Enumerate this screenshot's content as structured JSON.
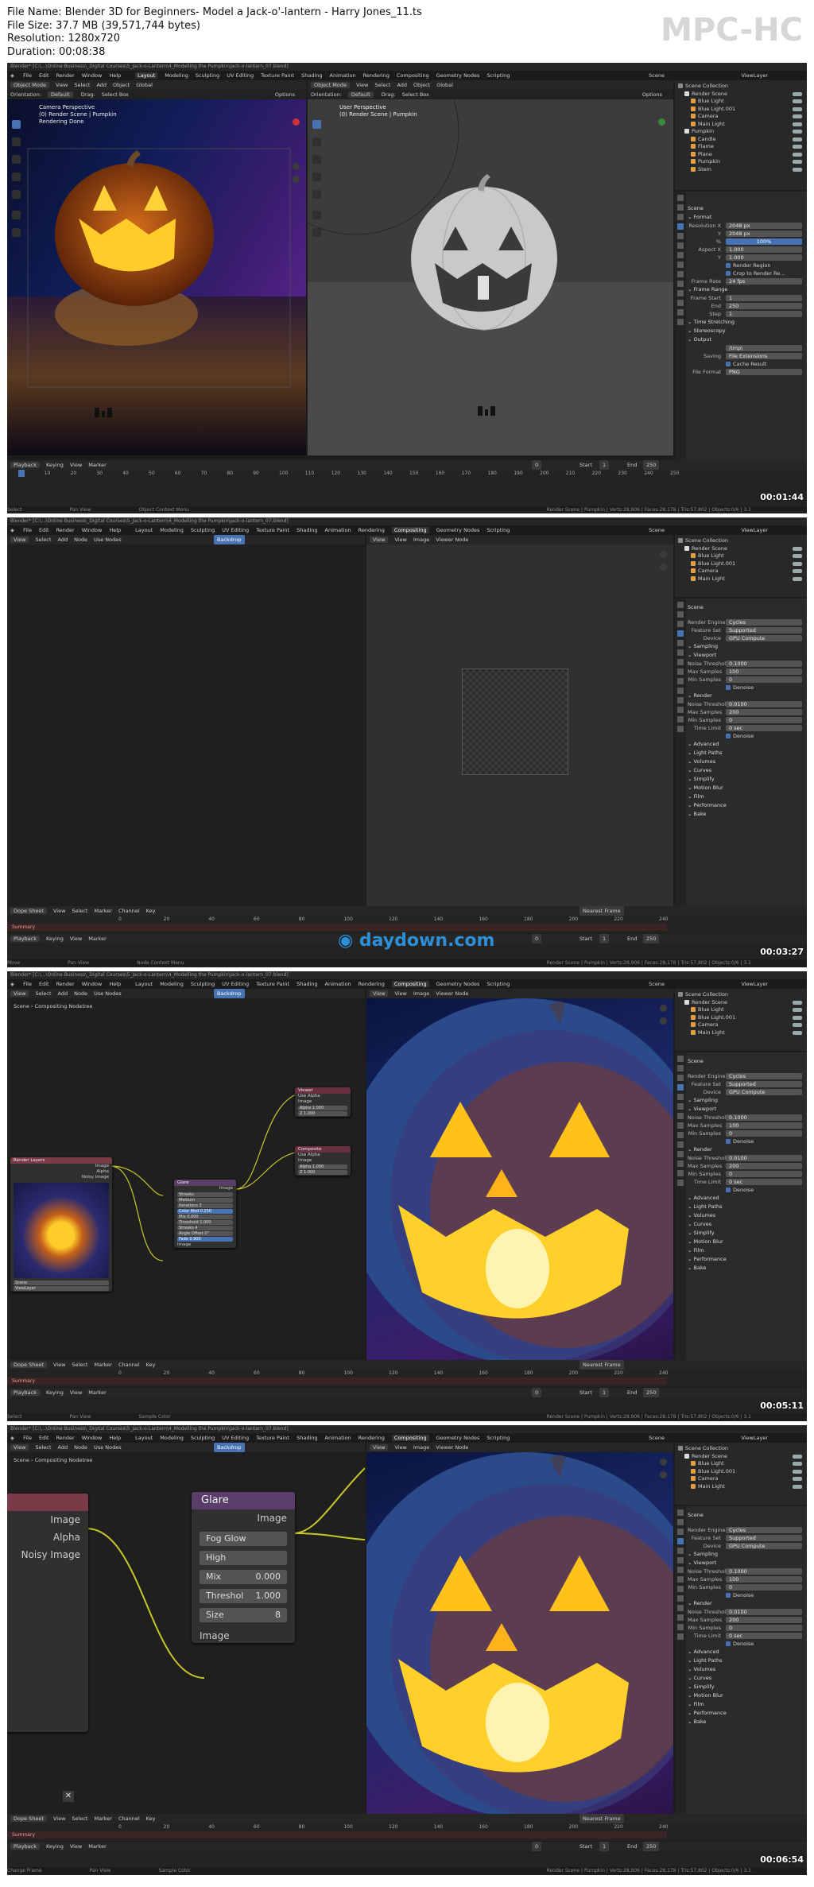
{
  "file_info": {
    "name_label": "File Name:",
    "name": "Blender 3D for Beginners- Model a Jack-o'-lantern - Harry Jones_11.ts",
    "size_label": "File Size:",
    "size": "37.7 MB (39,571,744 bytes)",
    "resolution_label": "Resolution:",
    "resolution": "1280x720",
    "duration_label": "Duration:",
    "duration": "00:08:38"
  },
  "brand": "MPC-HC",
  "watermark": "daydown.com",
  "menu": [
    "File",
    "Edit",
    "Render",
    "Window",
    "Help"
  ],
  "workspaces": [
    "Layout",
    "Modeling",
    "Sculpting",
    "UV Editing",
    "Texture Paint",
    "Shading",
    "Animation",
    "Rendering",
    "Compositing",
    "Geometry Nodes",
    "Scripting"
  ],
  "scene_label": "Scene",
  "viewlayer_label": "ViewLayer",
  "frame1": {
    "timestamp": "00:01:44",
    "active_ws": 0,
    "title": "Blender* [C:\\...\\Online Business\\_Digital Courses\\5_Jack-o-Lantern\\4_Modelling the Pumpkin\\jack-o-lantern_07.blend]",
    "left_header": [
      "Object Mode",
      "View",
      "Select",
      "Add",
      "Object",
      "Global"
    ],
    "right_header": [
      "Object Mode",
      "View",
      "Select",
      "Add",
      "Object",
      "Global"
    ],
    "orientation_label": "Orientation:",
    "orientation": "Default",
    "drag_label": "Drag:",
    "drag": "Select Box",
    "options": "Options",
    "left_overlay": [
      "Camera Perspective",
      "(0) Render Scene | Pumpkin",
      "Rendering Done"
    ],
    "right_overlay": [
      "User Perspective",
      "(0) Render Scene | Pumpkin"
    ],
    "outliner": [
      {
        "label": "Scene Collection",
        "d": 0
      },
      {
        "label": "Render Scene",
        "d": 1
      },
      {
        "label": "Blue Light",
        "d": 2
      },
      {
        "label": "Blue Light.001",
        "d": 2
      },
      {
        "label": "Camera",
        "d": 2
      },
      {
        "label": "Main Light",
        "d": 2
      },
      {
        "label": "Pumpkin",
        "d": 1
      },
      {
        "label": "Candle",
        "d": 2
      },
      {
        "label": "Flame",
        "d": 2
      },
      {
        "label": "Plane",
        "d": 2
      },
      {
        "label": "Pumpkin",
        "d": 2
      },
      {
        "label": "Stem",
        "d": 2
      }
    ],
    "props_scene": "Scene",
    "props": [
      {
        "type": "sec",
        "label": "Format"
      },
      {
        "label": "Resolution X",
        "value": "2048 px"
      },
      {
        "label": "Y",
        "value": "2048 px"
      },
      {
        "label": "%",
        "value": "100%",
        "blue": true
      },
      {
        "label": "Aspect X",
        "value": "1.000"
      },
      {
        "label": "Y",
        "value": "1.000"
      },
      {
        "type": "check",
        "label": "Render Region"
      },
      {
        "type": "check",
        "label": "Crop to Render Re..."
      },
      {
        "label": "Frame Rate",
        "value": "24 fps"
      },
      {
        "type": "sec",
        "label": "Frame Range"
      },
      {
        "label": "Frame Start",
        "value": "1"
      },
      {
        "label": "End",
        "value": "250"
      },
      {
        "label": "Step",
        "value": "1"
      },
      {
        "type": "sec",
        "label": "Time Stretching"
      },
      {
        "type": "sec",
        "label": "Stereoscopy"
      },
      {
        "type": "sec",
        "label": "Output"
      },
      {
        "label": "",
        "value": "/tmp\\"
      },
      {
        "label": "Saving",
        "value": "File Extensions"
      },
      {
        "type": "check",
        "label": "Cache Result"
      },
      {
        "label": "File Format",
        "value": "PNG"
      }
    ],
    "timeline_header": [
      "Playback",
      "Keying",
      "View",
      "Marker"
    ],
    "ruler": [
      "0",
      "10",
      "20",
      "30",
      "40",
      "50",
      "60",
      "70",
      "80",
      "90",
      "100",
      "110",
      "120",
      "130",
      "140",
      "150",
      "160",
      "170",
      "180",
      "190",
      "200",
      "210",
      "220",
      "230",
      "240",
      "250"
    ],
    "frame": "0",
    "start_label": "Start",
    "start": "1",
    "end_label": "End",
    "end": "250",
    "status": [
      "Select",
      "Pan View",
      "Object Context Menu"
    ],
    "stats": "Render Scene | Pumpkin | Verts:28,906 | Faces:28,178 | Tris:57,802 | Objects:0/6 | 3.1"
  },
  "compositor": {
    "header": [
      "View",
      "Select",
      "Add",
      "Node",
      "Use Nodes"
    ],
    "backdrop": "Backdrop",
    "image_header": [
      "View",
      "View",
      "Image",
      "Viewer Node"
    ],
    "outliner": [
      {
        "label": "Scene Collection",
        "d": 0
      },
      {
        "label": "Render Scene",
        "d": 1
      },
      {
        "label": "Blue Light",
        "d": 2
      },
      {
        "label": "Blue Light.001",
        "d": 2
      },
      {
        "label": "Camera",
        "d": 2
      },
      {
        "label": "Main Light",
        "d": 2
      }
    ],
    "props_scene": "Scene",
    "props": [
      {
        "label": "Render Engine",
        "value": "Cycles"
      },
      {
        "label": "Feature Set",
        "value": "Supported"
      },
      {
        "label": "Device",
        "value": "GPU Compute"
      },
      {
        "type": "sec",
        "label": "Sampling"
      },
      {
        "type": "sec",
        "label": "Viewport"
      },
      {
        "label": "Noise Threshold",
        "value": "0.1000"
      },
      {
        "label": "Max Samples",
        "value": "100"
      },
      {
        "label": "Min Samples",
        "value": "0"
      },
      {
        "type": "check",
        "label": "Denoise"
      },
      {
        "type": "sec",
        "label": "Render"
      },
      {
        "label": "Noise Threshold",
        "value": "0.0100"
      },
      {
        "label": "Max Samples",
        "value": "200"
      },
      {
        "label": "Min Samples",
        "value": "0"
      },
      {
        "label": "Time Limit",
        "value": "0 sec"
      },
      {
        "type": "check",
        "label": "Denoise"
      },
      {
        "type": "sec",
        "label": "Advanced"
      },
      {
        "type": "sec",
        "label": "Light Paths"
      },
      {
        "type": "sec",
        "label": "Volumes"
      },
      {
        "type": "sec",
        "label": "Curves"
      },
      {
        "type": "sec",
        "label": "Simplify"
      },
      {
        "type": "sec",
        "label": "Motion Blur"
      },
      {
        "type": "sec",
        "label": "Film"
      },
      {
        "type": "sec",
        "label": "Performance"
      },
      {
        "type": "sec",
        "label": "Bake"
      }
    ],
    "dope_header": [
      "Dope Sheet",
      "View",
      "Select",
      "Marker",
      "Channel",
      "Key"
    ],
    "nearest_frame": "Nearest Frame",
    "summary": "Summary",
    "ruler": [
      "0",
      "20",
      "40",
      "60",
      "80",
      "100",
      "120",
      "140",
      "160",
      "180",
      "200",
      "220",
      "240"
    ],
    "breadcrumb": [
      "Scene",
      "Compositing Nodetree"
    ]
  },
  "frame2": {
    "timestamp": "00:03:27",
    "status": [
      "Move",
      "Pan View",
      "Node Context Menu"
    ]
  },
  "frame3": {
    "timestamp": "00:05:11",
    "status": [
      "Select",
      "Pan View",
      "Sample Color"
    ],
    "nodes": {
      "render_layers": {
        "title": "Render Layers",
        "outputs": [
          "Image",
          "Alpha",
          "Noisy Image"
        ],
        "scene": "Scene",
        "layer": "ViewLayer"
      },
      "glare": {
        "title": "Glare",
        "output": "Image",
        "type": "Streaks",
        "quality": "Medium",
        "fields": [
          "Iterations 3",
          "Color Mod 0.250",
          "Mix 0.000",
          "Threshold 1.000",
          "Streaks 4",
          "Angle Offset 0°",
          "Fade 0.900"
        ],
        "input": "Image"
      },
      "viewer": {
        "title": "Viewer",
        "use_alpha": "Use Alpha",
        "inputs": [
          "Image",
          "Alpha 1.000",
          "Z 1.000"
        ]
      },
      "composite": {
        "title": "Composite",
        "use_alpha": "Use Alpha",
        "inputs": [
          "Image",
          "Alpha 1.000",
          "Z 1.000"
        ]
      }
    }
  },
  "frame4": {
    "timestamp": "00:06:54",
    "status": [
      "Change Frame",
      "Pan View",
      "Sample Color"
    ],
    "nodes": {
      "render_layers_outputs": [
        "Image",
        "Alpha",
        "Noisy Image"
      ],
      "glare": {
        "title": "Glare",
        "output": "Image",
        "type": "Fog Glow",
        "quality": "High",
        "mix_label": "Mix",
        "mix": "0.000",
        "threshold_label": "Threshol",
        "threshold": "1.000",
        "size_label": "Size",
        "size": "8",
        "input": "Image"
      }
    }
  }
}
